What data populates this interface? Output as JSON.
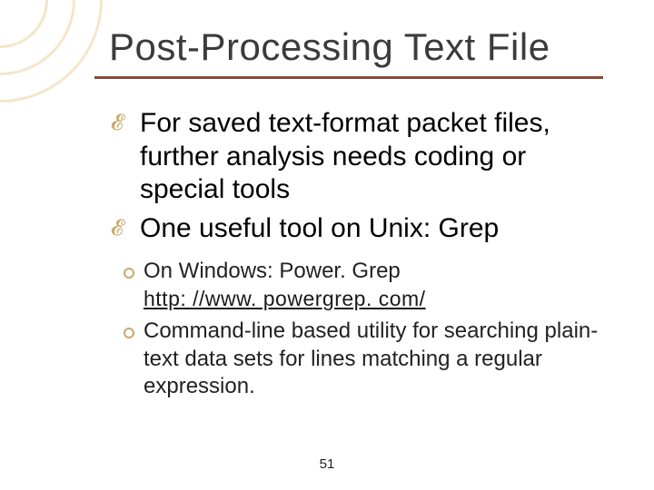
{
  "title": "Post-Processing Text File",
  "bullets": {
    "b1": "For saved text-format packet files, further analysis needs coding or special tools",
    "b2": "One useful tool on Unix:  Grep"
  },
  "sub": {
    "s1_prefix": "On Windows:  Power. Grep",
    "s1_link": "http: //www. powergrep. com/",
    "s2": "Command-line based utility for searching plain-text data sets for lines matching a regular expression."
  },
  "page_number": "51"
}
